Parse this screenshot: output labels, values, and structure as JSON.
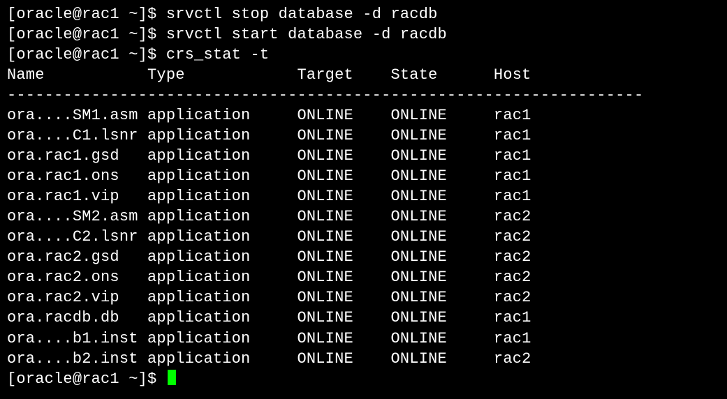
{
  "prompt": "[oracle@rac1 ~]$ ",
  "commands": [
    "srvctl stop database -d racdb",
    "srvctl start database -d racdb",
    "crs_stat -t"
  ],
  "headers": {
    "name": "Name",
    "type": "Type",
    "target": "Target",
    "state": "State",
    "host": "Host"
  },
  "separator": "--------------------------------------------------------------------",
  "rows": [
    {
      "name": "ora....SM1.asm",
      "type": "application",
      "target": "ONLINE",
      "state": "ONLINE",
      "host": "rac1"
    },
    {
      "name": "ora....C1.lsnr",
      "type": "application",
      "target": "ONLINE",
      "state": "ONLINE",
      "host": "rac1"
    },
    {
      "name": "ora.rac1.gsd",
      "type": "application",
      "target": "ONLINE",
      "state": "ONLINE",
      "host": "rac1"
    },
    {
      "name": "ora.rac1.ons",
      "type": "application",
      "target": "ONLINE",
      "state": "ONLINE",
      "host": "rac1"
    },
    {
      "name": "ora.rac1.vip",
      "type": "application",
      "target": "ONLINE",
      "state": "ONLINE",
      "host": "rac1"
    },
    {
      "name": "ora....SM2.asm",
      "type": "application",
      "target": "ONLINE",
      "state": "ONLINE",
      "host": "rac2"
    },
    {
      "name": "ora....C2.lsnr",
      "type": "application",
      "target": "ONLINE",
      "state": "ONLINE",
      "host": "rac2"
    },
    {
      "name": "ora.rac2.gsd",
      "type": "application",
      "target": "ONLINE",
      "state": "ONLINE",
      "host": "rac2"
    },
    {
      "name": "ora.rac2.ons",
      "type": "application",
      "target": "ONLINE",
      "state": "ONLINE",
      "host": "rac2"
    },
    {
      "name": "ora.rac2.vip",
      "type": "application",
      "target": "ONLINE",
      "state": "ONLINE",
      "host": "rac2"
    },
    {
      "name": "ora.racdb.db",
      "type": "application",
      "target": "ONLINE",
      "state": "ONLINE",
      "host": "rac1"
    },
    {
      "name": "ora....b1.inst",
      "type": "application",
      "target": "ONLINE",
      "state": "ONLINE",
      "host": "rac1"
    },
    {
      "name": "ora....b2.inst",
      "type": "application",
      "target": "ONLINE",
      "state": "ONLINE",
      "host": "rac2"
    }
  ],
  "final_prompt": "[oracle@rac1 ~]$ "
}
